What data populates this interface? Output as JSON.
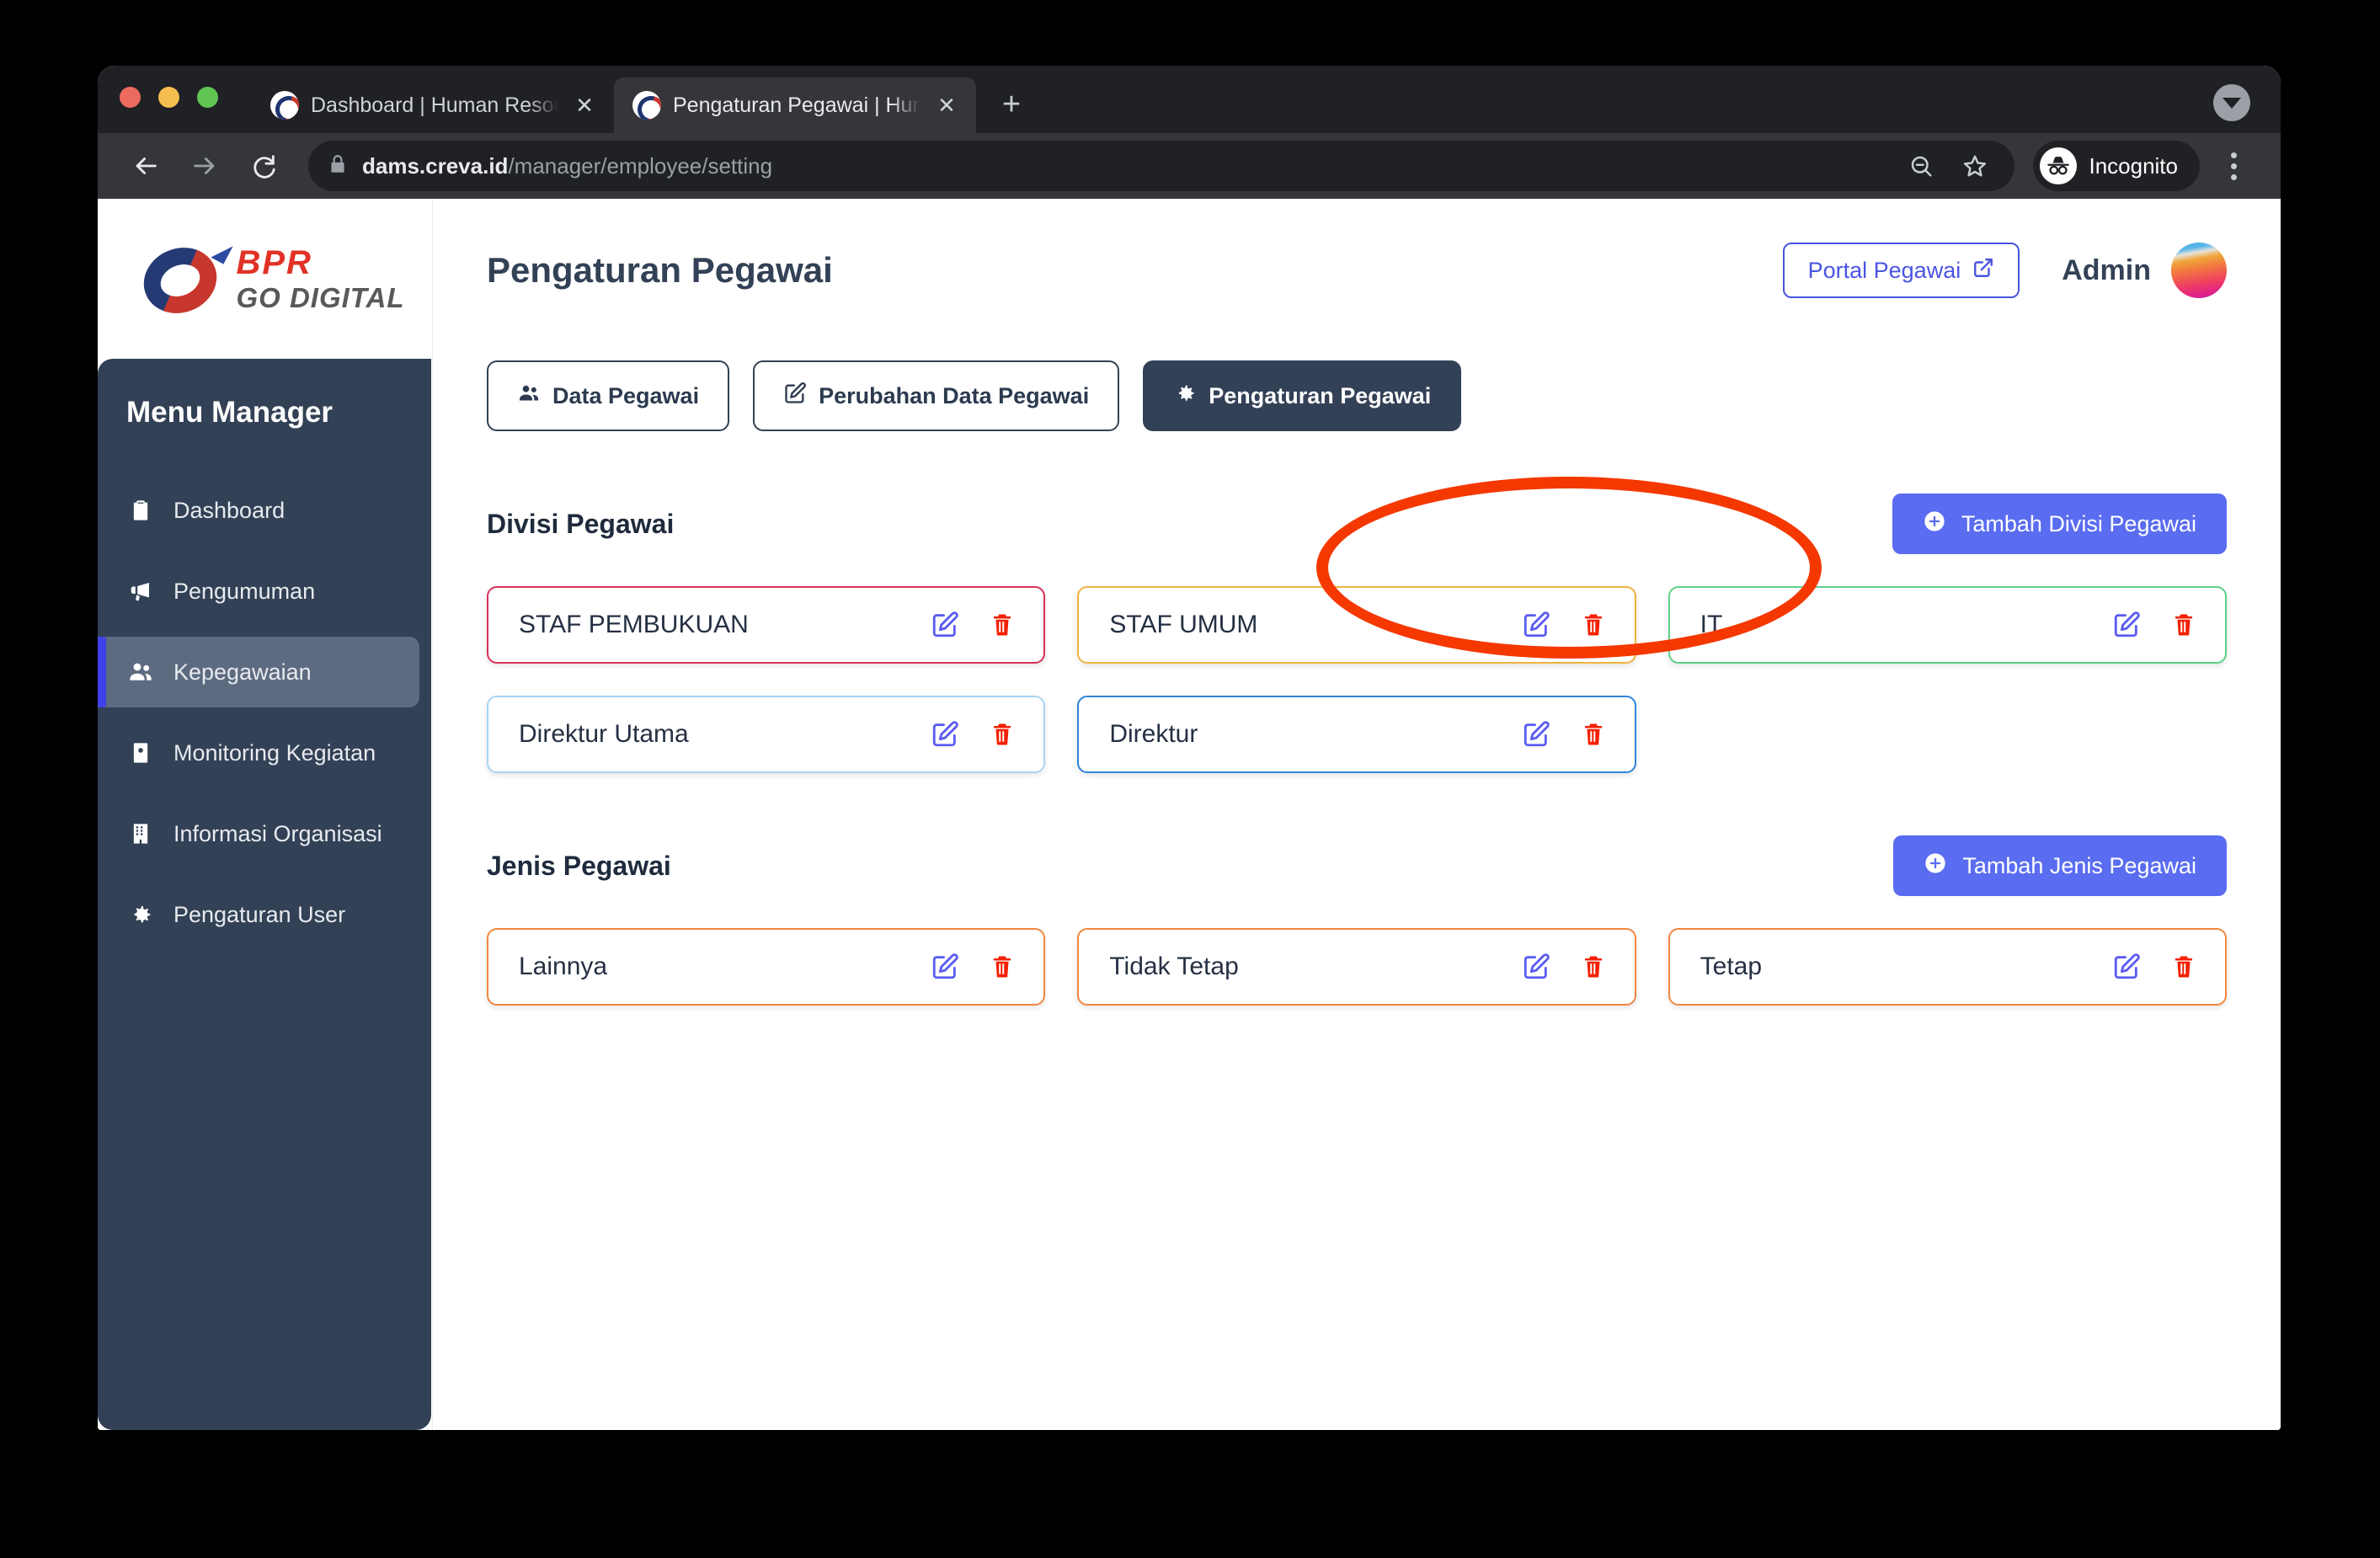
{
  "browser": {
    "tabs": [
      {
        "title": "Dashboard | Human Resource I",
        "favicon": "bpr-logo-favicon",
        "active": false,
        "close_label": "✕"
      },
      {
        "title": "Pengaturan Pegawai | Human R",
        "favicon": "bpr-logo-favicon",
        "active": true,
        "close_label": "✕"
      }
    ],
    "new_tab_label": "+",
    "url_domain": "dams.creva.id",
    "url_path": "/manager/employee/setting",
    "profile_label": "Incognito",
    "icons": {
      "back": "back-arrow-icon",
      "forward": "forward-arrow-icon",
      "reload": "reload-icon",
      "lock": "lock-icon",
      "zoom_out": "zoom-out-icon",
      "bookmark": "star-icon",
      "menu": "kebab-menu-icon",
      "tabstrip_expander": "chevron-down-circle-icon"
    }
  },
  "sidebar": {
    "brand": {
      "line1": "BPR",
      "line2": "GO DIGITAL"
    },
    "menu_title": "Menu Manager",
    "items": [
      {
        "label": "Dashboard",
        "icon": "clipboard-icon",
        "active": false
      },
      {
        "label": "Pengumuman",
        "icon": "megaphone-icon",
        "active": false
      },
      {
        "label": "Kepegawaian",
        "icon": "users-icon",
        "active": true
      },
      {
        "label": "Monitoring Kegiatan",
        "icon": "id-badge-icon",
        "active": false
      },
      {
        "label": "Informasi Organisasi",
        "icon": "building-icon",
        "active": false
      },
      {
        "label": "Pengaturan User",
        "icon": "gear-icon",
        "active": false
      }
    ]
  },
  "header": {
    "title": "Pengaturan Pegawai",
    "portal_button": "Portal Pegawai",
    "portal_icon": "external-link-icon",
    "user_name": "Admin"
  },
  "tabbar": [
    {
      "label": "Data Pegawai",
      "icon": "users-icon",
      "active": false
    },
    {
      "label": "Perubahan Data Pegawai",
      "icon": "edit-square-icon",
      "active": false
    },
    {
      "label": "Pengaturan Pegawai",
      "icon": "gear-icon",
      "active": true
    }
  ],
  "sections": [
    {
      "title": "Divisi Pegawai",
      "add_label": "Tambah Divisi Pegawai",
      "add_icon": "plus-circle-icon",
      "cards": [
        {
          "label": "STAF PEMBUKUAN",
          "border_color": "#d6325a"
        },
        {
          "label": "STAF UMUM",
          "border_color": "#eeb440"
        },
        {
          "label": "IT",
          "border_color": "#5ed08a"
        },
        {
          "label": "Direktur Utama",
          "border_color": "#a9d5f5"
        },
        {
          "label": "Direktur",
          "border_color": "#2f84d8"
        }
      ]
    },
    {
      "title": "Jenis Pegawai",
      "add_label": "Tambah Jenis Pegawai",
      "add_icon": "plus-circle-icon",
      "cards": [
        {
          "label": "Lainnya",
          "border_color": "#f0873f"
        },
        {
          "label": "Tidak Tetap",
          "border_color": "#f0873f"
        },
        {
          "label": "Tetap",
          "border_color": "#f0873f"
        }
      ]
    }
  ],
  "card_actions": {
    "edit_icon": "edit-square-icon",
    "delete_icon": "trash-icon"
  },
  "annotation": {
    "shape": "ellipse",
    "color": "#f53800",
    "targets": "pengaturan-pegawai-tab"
  }
}
